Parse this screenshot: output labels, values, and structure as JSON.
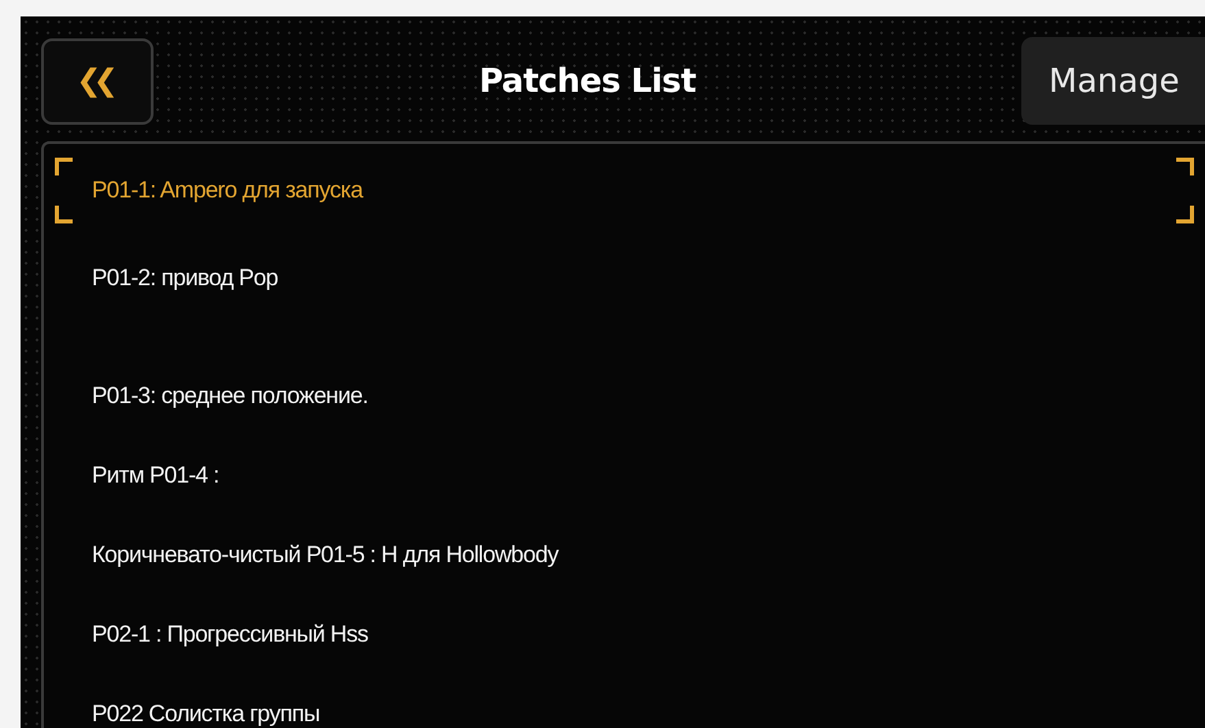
{
  "header": {
    "back_button": {
      "label": "❮❮"
    },
    "title": "Patches List",
    "manage_button": {
      "label": "Manage"
    }
  },
  "patches": [
    {
      "name": "P01-1: Ampero для запуска",
      "selected": true
    },
    {
      "name": "P01-2: привод Pop",
      "selected": false
    },
    {
      "name": "P01-3: среднее положение.",
      "selected": false
    },
    {
      "name": "Ритм P01-4 :",
      "selected": false
    },
    {
      "name": "Коричневато-чистый P01-5 : H для Hollowbody",
      "selected": false
    },
    {
      "name": "P02-1 : Прогрессивный Hss",
      "selected": false
    },
    {
      "name": "P022 Солистка группы",
      "selected": false
    }
  ]
}
